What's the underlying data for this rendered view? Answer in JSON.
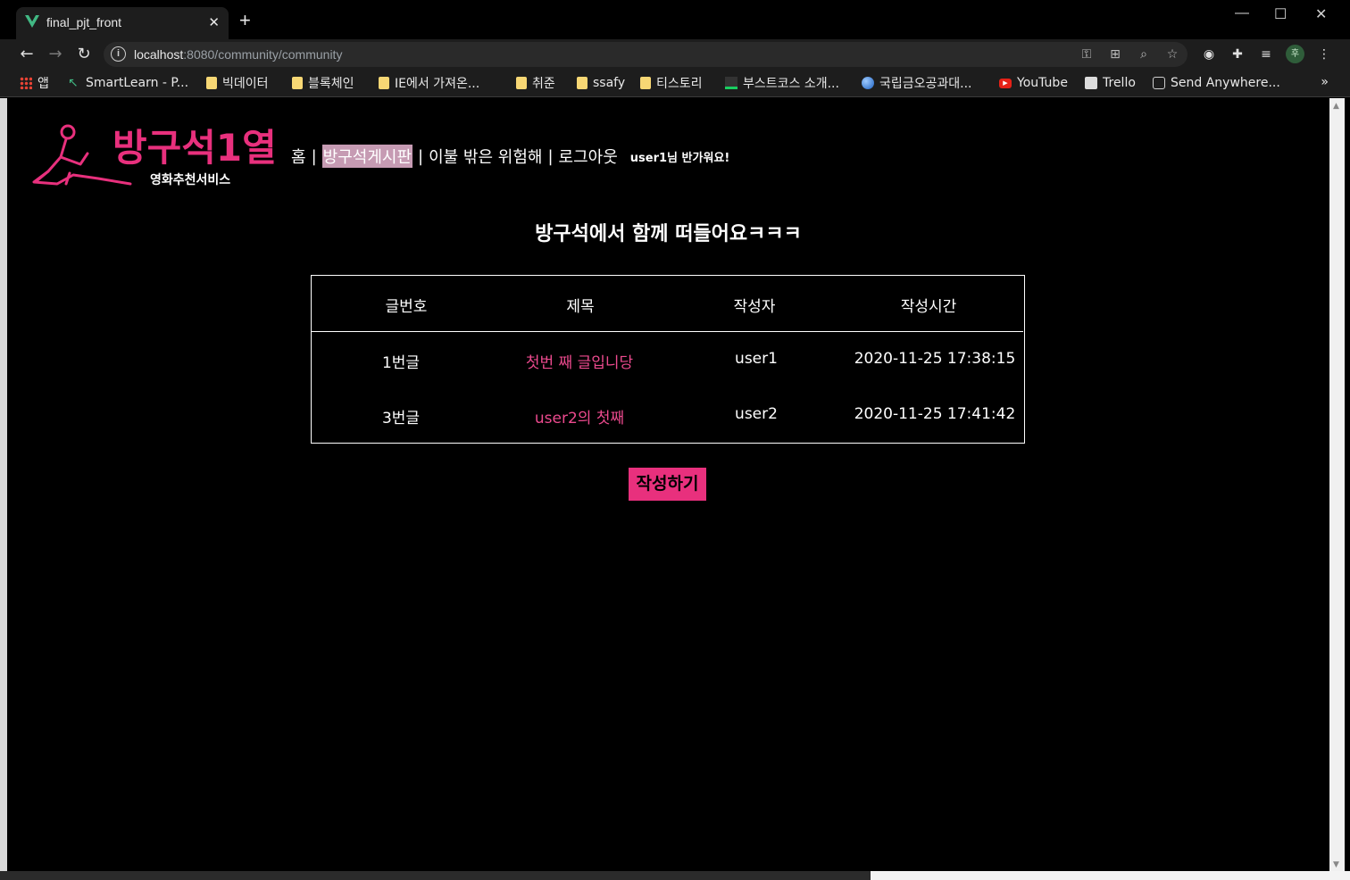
{
  "browser": {
    "tab_title": "final_pjt_front",
    "tab_close": "✕",
    "new_tab": "+",
    "window_controls": {
      "minimize": "—",
      "maximize": "☐",
      "close": "✕"
    },
    "url_host": "localhost",
    "url_rest": ":8080/community/community",
    "avatar_letter": "후",
    "bookmarks": [
      {
        "label": "앱",
        "icon": "apps-grid-icon"
      },
      {
        "label": "SmartLearn - P...",
        "icon": "smartlearn-icon"
      },
      {
        "label": "빅데이터",
        "icon": "folder-icon"
      },
      {
        "label": "블록체인",
        "icon": "folder-icon"
      },
      {
        "label": "IE에서 가져온...",
        "icon": "folder-icon"
      },
      {
        "label": "취준",
        "icon": "folder-icon"
      },
      {
        "label": "ssafy",
        "icon": "folder-icon"
      },
      {
        "label": "티스토리",
        "icon": "folder-icon"
      },
      {
        "label": "부스트코스 소개...",
        "icon": "boostcourse-icon"
      },
      {
        "label": "국립금오공과대...",
        "icon": "globe-icon"
      },
      {
        "label": "YouTube",
        "icon": "youtube-icon"
      },
      {
        "label": "Trello",
        "icon": "trello-icon"
      },
      {
        "label": "Send Anywhere...",
        "icon": "send-anywhere-icon"
      }
    ],
    "bookmarks_overflow": "»"
  },
  "site": {
    "logo_title": "방구석1열",
    "logo_subtitle": "영화추천서비스",
    "brand_color": "#e8307d",
    "nav": {
      "home": "홈",
      "board": "방구석게시판",
      "quiz": "이불 밖은 위험해",
      "logout": "로그아웃",
      "separator": "|",
      "greeting": "user1님 반가워요!"
    },
    "headline": "방구석에서 함께 떠들어요ㅋㅋㅋ",
    "table": {
      "headers": [
        "글번호",
        "제목",
        "작성자",
        "작성시간"
      ],
      "rows": [
        {
          "no": "1번글",
          "title": "첫번 째 글입니당",
          "author": "user1",
          "time": "2020-11-25 17:38:15"
        },
        {
          "no": "3번글",
          "title": "user2의 첫째",
          "author": "user2",
          "time": "2020-11-25 17:41:42"
        }
      ]
    },
    "write_button": "작성하기"
  }
}
